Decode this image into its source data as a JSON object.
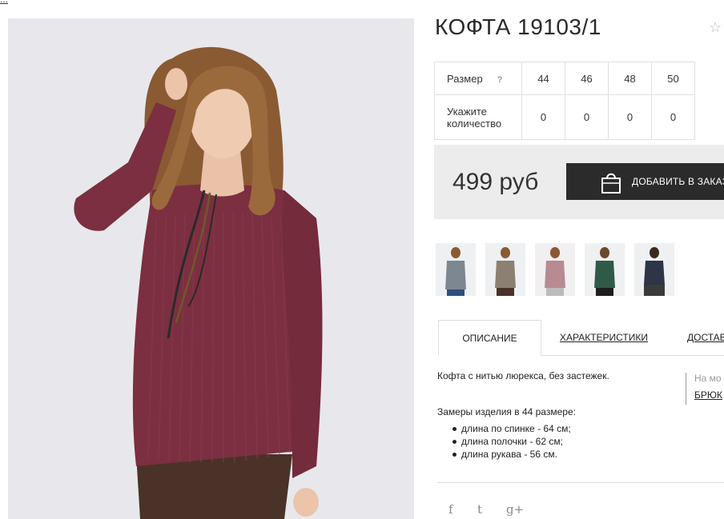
{
  "breadcrumb": {
    "text": "..."
  },
  "product": {
    "title": "КОФТА 19103/1",
    "favorite_icon": "star-outline-icon",
    "image_alt": "Model wearing burgundy ribbed sweater",
    "colors": {
      "sweater": "#7a2f3f",
      "background": "#e9e9ec",
      "button": "#2b2b2b",
      "pricebar": "#ececec"
    }
  },
  "sizes": {
    "size_label": "Размер",
    "help_label": "?",
    "size_values": [
      "44",
      "46",
      "48",
      "50"
    ],
    "qty_label_line1": "Укажите",
    "qty_label_line2": "количество",
    "qty_values": [
      "0",
      "0",
      "0",
      "0"
    ]
  },
  "purchase": {
    "price": "499 руб",
    "add_button_label": "ДОБАВИТЬ В ЗАКАЗ",
    "bag_icon": "shopping-bag-icon"
  },
  "tabs": {
    "description": "ОПИСАНИЕ",
    "characteristics": "ХАРАКТЕРИСТИКИ",
    "delivery": "ДОСТАВКА"
  },
  "description": {
    "text": "Кофта с нитью люрекса, без застежек.",
    "measurements_title": "Замеры изделия в 44 размере:",
    "items": [
      "длина по спинке - 64 см;",
      "длина полочки - 62 см;",
      "длина рукава - 56 см."
    ]
  },
  "side_info": {
    "line1": "На мо",
    "line2": "БРЮК"
  },
  "share": {
    "facebook": "f",
    "twitter": "t",
    "googleplus": "g+"
  }
}
